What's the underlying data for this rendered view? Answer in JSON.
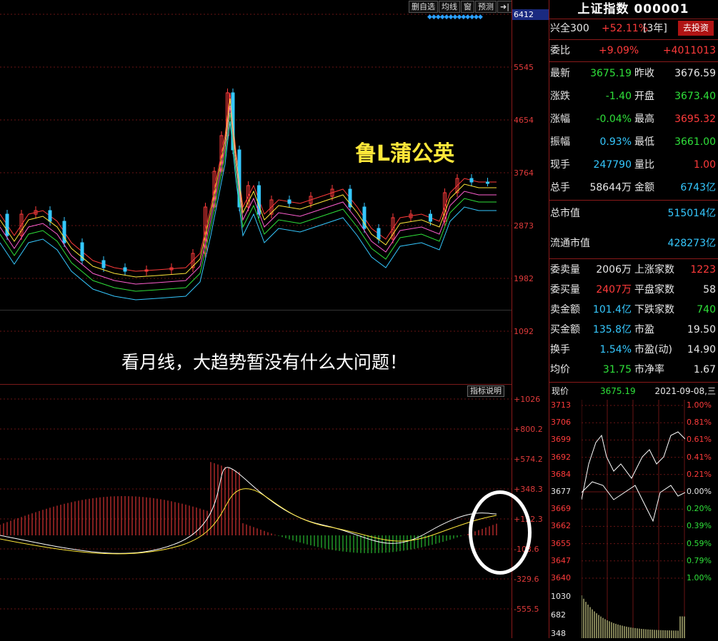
{
  "toolbar": {
    "buttons": [
      "删自选",
      "均线",
      "窗",
      "预测"
    ],
    "arrow": "➜|"
  },
  "main_axis": {
    "top_label": "6412",
    "labels": [
      "5545",
      "4654",
      "3764",
      "2873",
      "1982",
      "1092"
    ]
  },
  "indicator_axis": {
    "labels": [
      "+1026",
      "+800.2",
      "+574.2",
      "+348.3",
      "+122.3",
      "-103.6",
      "-329.6",
      "-555.5"
    ]
  },
  "watermark": "鲁L蒲公英",
  "comment": "看月线，大趋势暂没有什么大问题！",
  "indicator_button": "指标说明",
  "panel": {
    "title": "上证指数 000001",
    "fund": {
      "name": "兴全300",
      "gain": "+52.11%",
      "period": "[3年]",
      "button": "去投资"
    },
    "weibi": {
      "label": "委比",
      "ratio": "+9.09%",
      "diff": "+4011013"
    },
    "quote_rows": [
      {
        "l1": "最新",
        "v1": "3675.19",
        "c1": "green",
        "l2": "昨收",
        "v2": "3676.59",
        "c2": "white"
      },
      {
        "l1": "涨跌",
        "v1": "-1.40",
        "c1": "green",
        "l2": "开盘",
        "v2": "3673.40",
        "c2": "green"
      },
      {
        "l1": "涨幅",
        "v1": "-0.04%",
        "c1": "green",
        "l2": "最高",
        "v2": "3695.32",
        "c2": "red"
      },
      {
        "l1": "振幅",
        "v1": "0.93%",
        "c1": "cyan",
        "l2": "最低",
        "v2": "3661.00",
        "c2": "green"
      },
      {
        "l1": "现手",
        "v1": "247790",
        "c1": "cyan",
        "l2": "量比",
        "v2": "1.00",
        "c2": "red"
      },
      {
        "l1": "总手",
        "v1": "58644万",
        "c1": "white",
        "l2": "金额",
        "v2": "6743亿",
        "c2": "cyan"
      }
    ],
    "market_value": {
      "label": "总市值",
      "value": "515014亿"
    },
    "float_value": {
      "label": "流通市值",
      "value": "428273亿"
    },
    "stat_rows": [
      {
        "l1": "委卖量",
        "v1": "2006万",
        "c1": "white",
        "l2": "上涨家数",
        "v2": "1223",
        "c2": "red"
      },
      {
        "l1": "委买量",
        "v1": "2407万",
        "c1": "red",
        "l2": "平盘家数",
        "v2": "58",
        "c2": "white"
      },
      {
        "l1": "卖金额",
        "v1": "101.4亿",
        "c1": "cyan",
        "l2": "下跌家数",
        "v2": "740",
        "c2": "green"
      },
      {
        "l1": "买金额",
        "v1": "135.8亿",
        "c1": "cyan",
        "l2": "市盈",
        "v2": "19.50",
        "c2": "white"
      },
      {
        "l1": "换手",
        "v1": "1.54%",
        "c1": "cyan",
        "l2": "市盈(动)",
        "v2": "14.90",
        "c2": "white"
      },
      {
        "l1": "均价",
        "v1": "31.75",
        "c1": "green",
        "l2": "市净率",
        "v2": "1.67",
        "c2": "white"
      }
    ],
    "mini_head": {
      "label": "现价",
      "price": "3675.19",
      "date": "2021-09-08,三"
    },
    "mini_left": [
      "3713",
      "3706",
      "3699",
      "3692",
      "3684",
      "3677",
      "3669",
      "3662",
      "3655",
      "3647",
      "3640",
      "1030",
      "682",
      "348"
    ],
    "mini_right": [
      "1.00%",
      "0.81%",
      "0.61%",
      "0.41%",
      "0.21%",
      "0.00%",
      "0.20%",
      "0.39%",
      "0.59%",
      "0.79%",
      "1.00%"
    ]
  },
  "colors": {
    "up": "#ff3b3b",
    "down": "#2fe03a",
    "axis": "#e03a3a",
    "grid": "#7a1a1a",
    "highlight": "#ffe83a"
  }
}
